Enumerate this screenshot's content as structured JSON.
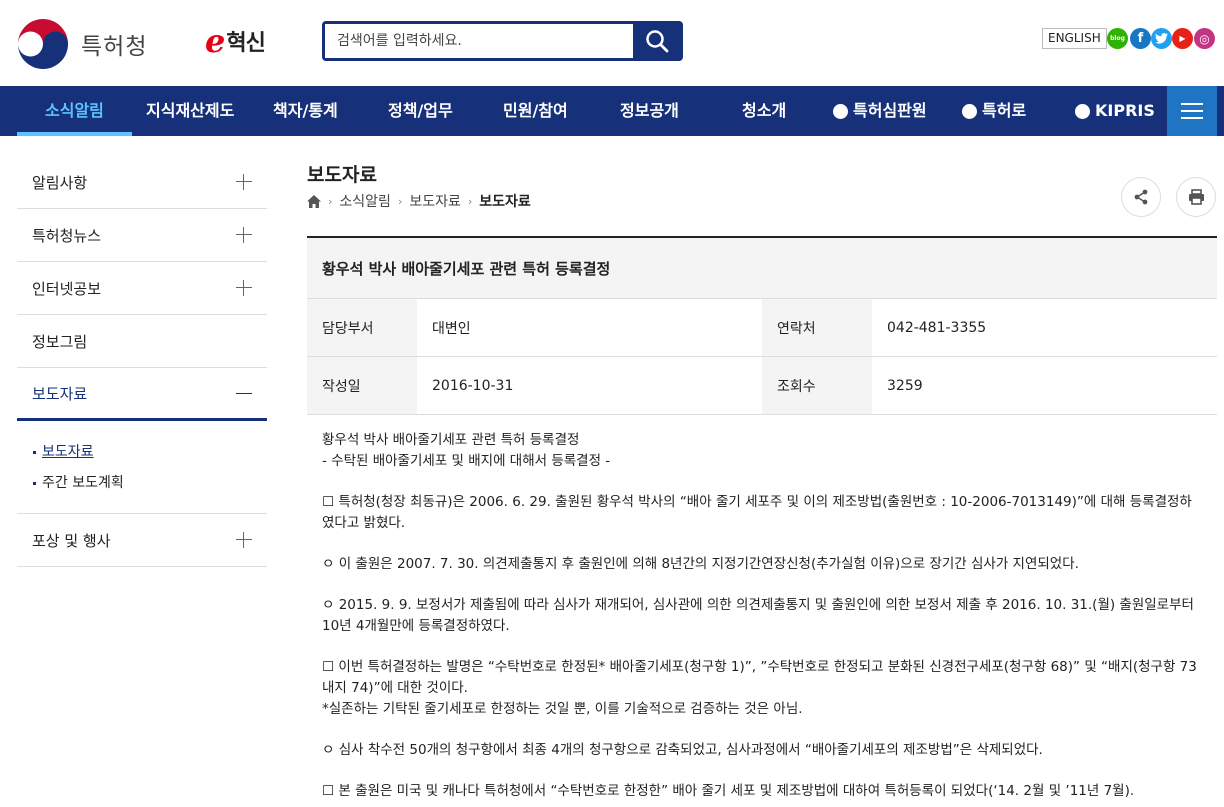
{
  "header": {
    "logo_text": "특허청",
    "einno_mark": "e",
    "einno_text": "혁신",
    "search_placeholder": "검색어를 입력하세요.",
    "english_label": "ENGLISH",
    "sns": [
      {
        "name": "blog",
        "label": "blog",
        "color": "#2db400"
      },
      {
        "name": "facebook",
        "label": "f",
        "color": "#1877c2"
      },
      {
        "name": "twitter",
        "label": "t",
        "color": "#1da1f2"
      },
      {
        "name": "youtube",
        "label": "▶",
        "color": "#e62117"
      },
      {
        "name": "instagram",
        "label": "◎",
        "color": "#c13584"
      }
    ]
  },
  "gnb": {
    "items": [
      {
        "label": "소식알림",
        "active": true
      },
      {
        "label": "지식재산제도"
      },
      {
        "label": "책자/통계"
      },
      {
        "label": "정책/업무"
      },
      {
        "label": "민원/참여"
      },
      {
        "label": "정보공개"
      },
      {
        "label": "청소개"
      },
      {
        "label": "특허심판원"
      },
      {
        "label": "특허로"
      },
      {
        "label": "KIPRIS"
      }
    ]
  },
  "lnb": {
    "items": [
      {
        "label": "알림사항"
      },
      {
        "label": "특허청뉴스"
      },
      {
        "label": "인터넷공보"
      },
      {
        "label": "정보그림"
      },
      {
        "label": "보도자료"
      },
      {
        "label": "포상 및 행사"
      }
    ],
    "sub_items": [
      {
        "label": "보도자료"
      },
      {
        "label": "주간 보도계획"
      }
    ]
  },
  "page": {
    "title": "보도자료",
    "breadcrumb": [
      "소식알림",
      "보도자료",
      "보도자료"
    ]
  },
  "article": {
    "title": "황우석 박사 배아줄기세포 관련 특허 등록결정",
    "labels": {
      "dept": "담당부서",
      "contact": "연락처",
      "date": "작성일",
      "views": "조회수"
    },
    "dept": "대변인",
    "contact": "042-481-3355",
    "date": "2016-10-31",
    "views": "3259",
    "body": [
      "황우석 박사 배아줄기세포 관련 특허 등록결정",
      "- 수탁된 배아줄기세포 및 배지에 대해서 등록결정 -",
      "☐ 특허청(청장 최동규)은 2006. 6. 29. 출원된 황우석 박사의 “배아 줄기 세포주 및 이의 제조방법(출원번호 : 10-2006-7013149)”에 대해 등록결정하였다고 밝혔다.",
      "ㅇ 이 출원은 2007. 7. 30. 의견제출통지 후 출원인에 의해 8년간의 지정기간연장신청(추가실험 이유)으로 장기간 심사가 지연되었다.",
      "ㅇ 2015. 9. 9. 보정서가 제출됨에 따라 심사가 재개되어, 심사관에 의한 의견제출통지 및 출원인에 의한 보정서 제출 후 2016. 10. 31.(월) 출원일로부터 10년 4개월만에 등록결정하였다.",
      "☐ 이번 특허결정하는 발명은 “수탁번호로 한정된* 배아줄기세포(청구항 1)”, ”수탁번호로 한정되고 분화된 신경전구세포(청구항 68)” 및 “배지(청구항 73 내지 74)”에 대한 것이다.",
      "*실존하는 기탁된 줄기세포로 한정하는 것일 뿐, 이를 기술적으로 검증하는 것은 아님.",
      "ㅇ 심사 착수전 50개의 청구항에서 최종 4개의 청구항으로 감축되었고, 심사과정에서 “배아줄기세포의 제조방법”은 삭제되었다.",
      "☐ 본 출원은 미국 및 캐나다 특허청에서 “수탁번호로 한정한” 배아 줄기 세포 및 제조방법에 대하여 특허등록이 되었다(‘14. 2월 및 ’11년 7월)."
    ]
  },
  "colors": {
    "navy": "#16307a",
    "accent": "#5cc3ff",
    "menu_blue": "#1f74c4"
  }
}
